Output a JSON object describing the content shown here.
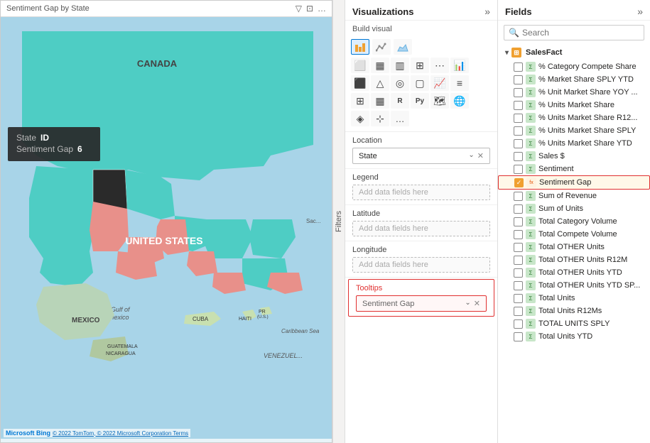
{
  "map": {
    "title": "Sentiment Gap by State",
    "tooltip": {
      "state_label": "State",
      "state_value": "ID",
      "gap_label": "Sentiment Gap",
      "gap_value": "6"
    },
    "credit": "© 2022 TomTom, © 2022 Microsoft Corporation Terms",
    "bing_logo": "Microsoft Bing",
    "icons": [
      "⊞",
      "⊟",
      "…"
    ]
  },
  "filters": {
    "label": "Filters"
  },
  "visualizations": {
    "header": "Visualizations",
    "expand_icon": "»",
    "build_visual": "Build visual",
    "icon_rows": [
      [
        "bar-chart",
        "stacked-bar",
        "bar-100",
        "clustered-bar",
        "stacked-col",
        "bar-line"
      ],
      [
        "line-chart",
        "area-chart",
        "stacked-area",
        "ribbon-chart",
        "waterfall",
        "scatter"
      ],
      [
        "pie-chart",
        "donut-chart",
        "treemap",
        "funnel",
        "gauge",
        "card"
      ],
      [
        "kpi",
        "slicer",
        "table",
        "matrix",
        "R-visual",
        "python-visual"
      ],
      [
        "map-icon",
        "filled-map",
        "shape-map",
        "decomp-tree",
        "ai-insights",
        "qna"
      ],
      [
        "more-icon",
        "smart-narrative"
      ]
    ],
    "wells": {
      "location": {
        "label": "Location",
        "value": "State",
        "has_value": true
      },
      "legend": {
        "label": "Legend",
        "placeholder": "Add data fields here"
      },
      "latitude": {
        "label": "Latitude",
        "placeholder": "Add data fields here"
      },
      "longitude": {
        "label": "Longitude",
        "placeholder": "Add data fields here"
      },
      "tooltips": {
        "label": "Tooltips",
        "value": "Sentiment Gap",
        "has_value": true,
        "highlighted": true
      }
    }
  },
  "fields": {
    "header": "Fields",
    "expand_icon": "»",
    "search_placeholder": "Search",
    "table": {
      "name": "SalesFact",
      "icon": "⊞"
    },
    "items": [
      {
        "label": "% Category Compete Share",
        "checked": false,
        "type": "sigma"
      },
      {
        "label": "% Market Share SPLY YTD",
        "checked": false,
        "type": "sigma"
      },
      {
        "label": "% Unit Market Share YOY ...",
        "checked": false,
        "type": "sigma"
      },
      {
        "label": "% Units Market Share",
        "checked": false,
        "type": "sigma"
      },
      {
        "label": "% Units Market Share R12...",
        "checked": false,
        "type": "sigma"
      },
      {
        "label": "% Units Market Share SPLY",
        "checked": false,
        "type": "sigma"
      },
      {
        "label": "% Units Market Share YTD",
        "checked": false,
        "type": "sigma"
      },
      {
        "label": "Sales $",
        "checked": false,
        "type": "sigma"
      },
      {
        "label": "Sentiment",
        "checked": false,
        "type": "sigma"
      },
      {
        "label": "Sentiment Gap",
        "checked": true,
        "type": "calc",
        "highlight": true
      },
      {
        "label": "Sum of Revenue",
        "checked": false,
        "type": "sigma"
      },
      {
        "label": "Sum of Units",
        "checked": false,
        "type": "sigma"
      },
      {
        "label": "Total Category Volume",
        "checked": false,
        "type": "sigma"
      },
      {
        "label": "Total Compete Volume",
        "checked": false,
        "type": "sigma"
      },
      {
        "label": "Total OTHER Units",
        "checked": false,
        "type": "sigma"
      },
      {
        "label": "Total OTHER Units R12M",
        "checked": false,
        "type": "sigma"
      },
      {
        "label": "Total OTHER Units YTD",
        "checked": false,
        "type": "sigma"
      },
      {
        "label": "Total OTHER Units YTD SP...",
        "checked": false,
        "type": "sigma"
      },
      {
        "label": "Total Units",
        "checked": false,
        "type": "sigma"
      },
      {
        "label": "Total Units R12Ms",
        "checked": false,
        "type": "sigma"
      },
      {
        "label": "TOTAL UNITS SPLY",
        "checked": false,
        "type": "sigma"
      },
      {
        "label": "Total Units YTD",
        "checked": false,
        "type": "sigma"
      }
    ]
  }
}
